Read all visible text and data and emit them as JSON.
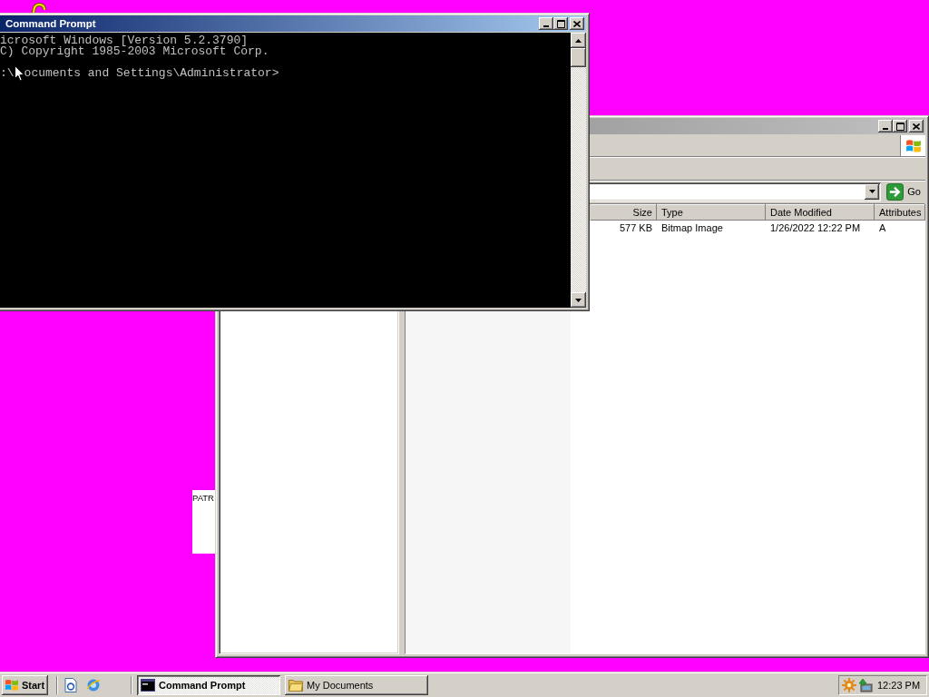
{
  "desktop": {
    "panel_text": "PATR"
  },
  "explorer": {
    "active": false,
    "go_label": "Go",
    "columns": [
      "Size",
      "Type",
      "Date Modified",
      "Attributes"
    ],
    "rows": [
      {
        "cells": [
          "577 KB",
          "Bitmap Image",
          "1/26/2022 12:22 PM",
          "A"
        ]
      }
    ]
  },
  "command_prompt": {
    "title": "Command Prompt",
    "active": true,
    "lines": [
      "icrosoft Windows [Version 5.2.3790]",
      "C) Copyright 1985-2003 Microsoft Corp."
    ],
    "prompt_before_pointer": ":\\",
    "prompt_after_pointer": "ocuments and Settings\\Administrator>"
  },
  "taskbar": {
    "start_label": "Start",
    "tasks": [
      {
        "label": "Command Prompt",
        "kind": "console",
        "selected": true
      },
      {
        "label": "My Documents",
        "kind": "folder",
        "selected": false
      }
    ],
    "clock": "12:23 PM"
  }
}
